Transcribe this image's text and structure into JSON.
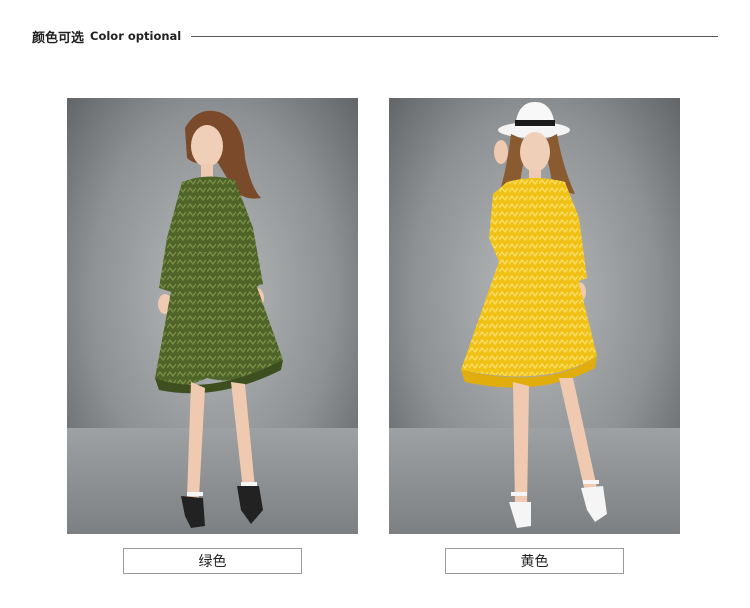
{
  "header": {
    "title_cn": "颜色可选",
    "title_en": "Color optional"
  },
  "options": [
    {
      "label": "绿色",
      "color": "#556b2f"
    },
    {
      "label": "黄色",
      "color": "#f2c21b"
    }
  ],
  "colors": {
    "background_gray": "#8f9294",
    "rule": "#555555"
  }
}
